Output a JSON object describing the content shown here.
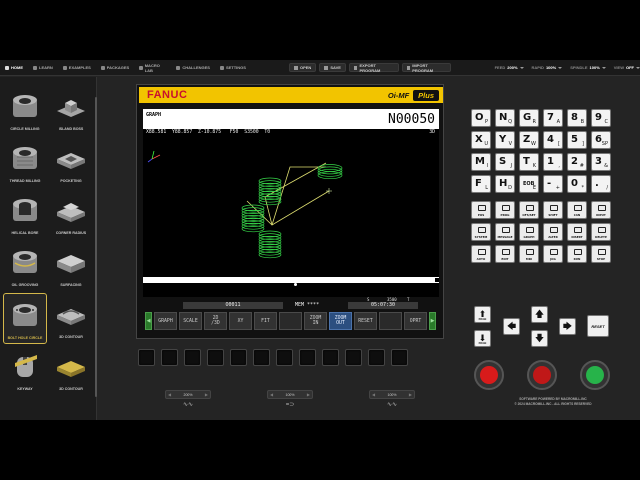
{
  "nav": {
    "home": "HOME",
    "learn": "LEARN",
    "examples": "EXAMPLES",
    "packages": "PACKAGES",
    "macro_lab": "MACRO LAB",
    "challenges": "CHALLENGES",
    "settings": "SETTINGS"
  },
  "toolbar": {
    "open": "OPEN",
    "save": "SAVE",
    "export": "EXPORT PROGRAM",
    "import": "IMPORT PROGRAM",
    "feed_label": "FEED",
    "feed_value": "200%",
    "rapid_label": "RAPID",
    "rapid_value": "100%",
    "spindle_label": "SPINDLE",
    "spindle_value": "100%",
    "view_label": "VIEW",
    "view_value": "OFF"
  },
  "sidebar": {
    "items": [
      {
        "label": "CIRCLE MILLING"
      },
      {
        "label": "ISLAND BOSS"
      },
      {
        "label": "THREAD MILLING"
      },
      {
        "label": "POCKETING"
      },
      {
        "label": "HELICAL BORE"
      },
      {
        "label": "CORNER RADIUS"
      },
      {
        "label": "OIL GROOVING"
      },
      {
        "label": "SURFACING"
      },
      {
        "label": "BOLT HOLE CIRCLE"
      },
      {
        "label": "3D CONTOUR"
      },
      {
        "label": "KEYWAY"
      },
      {
        "label": "3D CONTOUR"
      }
    ]
  },
  "screen": {
    "brand": "FANUC",
    "model": "Oi-MF",
    "model_plus": "Plus",
    "mode_title": "GRAPH",
    "program_number": "N00050",
    "coords": "X88.581  Y88.857  Z-10.875   F50  S3500  T0",
    "view_dim": "3D",
    "status_s": "S",
    "status_s_value": "3500",
    "status_t": "T",
    "program_name": "O0011",
    "mem": "MEM ****",
    "time": "05:07:30",
    "softkeys": [
      "GRAPH",
      "SCALE",
      "2D\n/3D",
      "XY",
      "FIT",
      "",
      "ZOOM\nIN",
      "ZOOM\nOUT",
      "RESET",
      "",
      "OPRT"
    ]
  },
  "knobs": [
    {
      "value": "200%",
      "icon": "feed-wave"
    },
    {
      "value": "100%",
      "icon": "rapid"
    },
    {
      "value": "100%",
      "icon": "spindle"
    }
  ],
  "keypad": {
    "rows": [
      [
        [
          "O",
          "P"
        ],
        [
          "N",
          "Q"
        ],
        [
          "G",
          "R"
        ],
        [
          "7",
          "A"
        ],
        [
          "8",
          "B"
        ],
        [
          "9",
          "C"
        ]
      ],
      [
        [
          "X",
          "U"
        ],
        [
          "Y",
          "V"
        ],
        [
          "Z",
          "W"
        ],
        [
          "4",
          "["
        ],
        [
          "5",
          "]"
        ],
        [
          "6",
          "SP"
        ]
      ],
      [
        [
          "M",
          "I"
        ],
        [
          "S",
          "J"
        ],
        [
          "T",
          "K"
        ],
        [
          "1",
          ","
        ],
        [
          "2",
          "#"
        ],
        [
          "3",
          "&"
        ]
      ],
      [
        [
          "F",
          "L"
        ],
        [
          "H",
          "D"
        ],
        [
          "EOB",
          "E"
        ],
        [
          "-",
          "+"
        ],
        [
          "0",
          "*"
        ],
        [
          ".",
          "/"
        ]
      ]
    ],
    "func_rows": [
      [
        "POS",
        "PROG",
        "OFS/SET",
        "SHIFT",
        "CAN",
        "INPUT"
      ],
      [
        "SYSTEM",
        "MESSAGE",
        "GRAPH",
        "ALTER",
        "INSERT",
        "DELETE"
      ],
      [
        "AUTO",
        "EDIT",
        "MDI",
        "JOG",
        "RUN",
        "STOP"
      ]
    ],
    "page_up": "PAGE",
    "page_down": "PAGE",
    "reset": "RESET"
  },
  "footer": {
    "line1": "SOFTWARE POWERED BY MACROMILL.INC",
    "line2": "© 2024 MACROMILL.INC - ALL RIGHTS RESERVED"
  },
  "colors": {
    "accent_yellow": "#f2c400",
    "fanuc_red": "#c8102e",
    "toolpath_green": "#37d84a",
    "softkey_blue": "#2c4f80"
  }
}
